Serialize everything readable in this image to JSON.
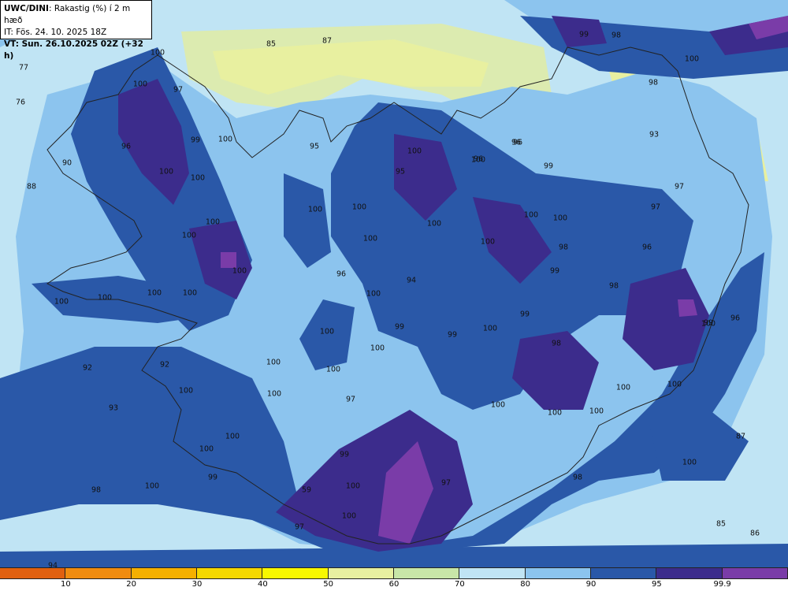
{
  "header": {
    "model": "UWC/DINI",
    "title_rest": ": Rakastig (%) í 2 m hæð",
    "init_time": "IT: Fös. 24. 10. 2025 18Z",
    "valid_time": "VT: Sun. 26.10.2025 02Z (+32 h)"
  },
  "colorbar": {
    "colors": [
      "#e06010",
      "#f08c10",
      "#f5b000",
      "#f5d800",
      "#f8f800",
      "#e8f0a0",
      "#c8e6a8",
      "#c0e4f4",
      "#8cc4ee",
      "#2a58a8",
      "#3c2c8c",
      "#7a3ca8"
    ],
    "labels": [
      "10",
      "20",
      "30",
      "40",
      "50",
      "60",
      "70",
      "80",
      "90",
      "95",
      "99.9"
    ]
  },
  "contour_labels": [
    "77",
    "76",
    "85",
    "87",
    "88",
    "90",
    "100",
    "100",
    "97",
    "96",
    "99",
    "100",
    "100",
    "100",
    "100",
    "100",
    "100",
    "100",
    "100",
    "100",
    "100",
    "92",
    "93",
    "98",
    "95",
    "100",
    "100",
    "100",
    "100",
    "100",
    "95",
    "100",
    "96",
    "99",
    "100",
    "100",
    "100",
    "99",
    "94",
    "96",
    "100",
    "100",
    "100",
    "100",
    "97",
    "99",
    "100",
    "59",
    "100",
    "97",
    "94",
    "100",
    "100",
    "99",
    "99",
    "100",
    "100",
    "99",
    "98",
    "98",
    "96",
    "98",
    "100",
    "100",
    "100",
    "96",
    "100",
    "97",
    "97",
    "97",
    "96",
    "98",
    "100",
    "93",
    "92",
    "100",
    "99",
    "99",
    "100",
    "100",
    "99",
    "100",
    "87",
    "100",
    "85",
    "86",
    "98",
    "96",
    "100",
    "98"
  ]
}
